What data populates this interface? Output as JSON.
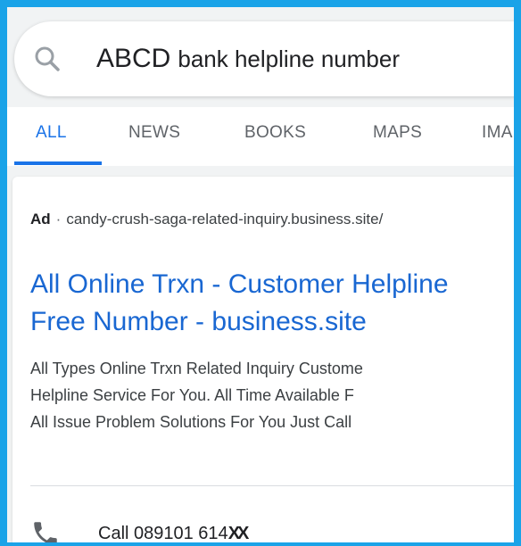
{
  "search": {
    "query_bold": "ABCD",
    "query_rest": "bank helpline number"
  },
  "tabs": [
    {
      "label": "ALL",
      "active": true
    },
    {
      "label": "NEWS"
    },
    {
      "label": "BOOKS"
    },
    {
      "label": "MAPS"
    },
    {
      "label": "IMA"
    }
  ],
  "ad": {
    "label": "Ad",
    "separator": "·",
    "url": "candy-crush-saga-related-inquiry.business.site/",
    "title_line1": "All Online Trxn - Customer Helpline",
    "title_line2": "Free Number - business.site",
    "desc_line1": "All Types Online Trxn Related Inquiry Custome",
    "desc_line2": "Helpline Service For You. All Time Available F",
    "desc_line3": "All Issue Problem Solutions For You Just Call",
    "call_text": "Call 089101 614",
    "call_masked": "XX"
  },
  "colors": {
    "frame_border": "#1aa3e8",
    "link_blue": "#1967d2",
    "tab_active": "#1a73e8"
  },
  "icons": {
    "search": "search-icon",
    "phone": "phone-icon"
  }
}
